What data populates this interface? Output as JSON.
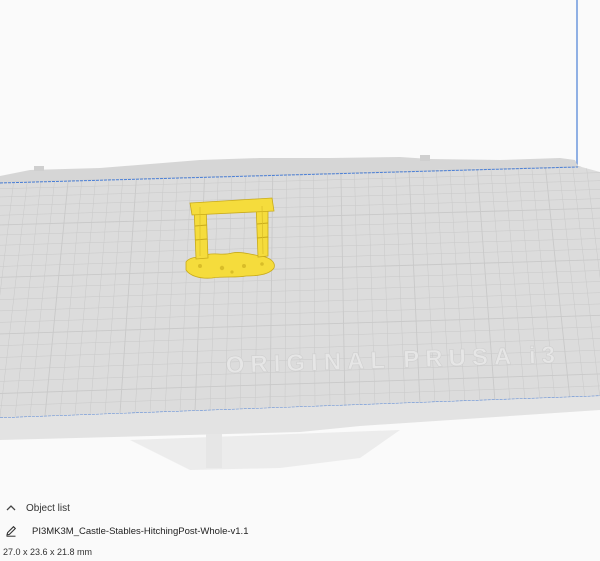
{
  "viewport": {
    "bed_logo_text": "ORIGINAL PRUSA i3",
    "model_color": "#f5dc3c",
    "bed_color": "#dcdcdc",
    "grid_color": "#c9c9c9",
    "edge_color": "#4a7fd6"
  },
  "object_list": {
    "title": "Object list",
    "collapse_icon": "chevron-up-icon",
    "edit_icon": "pencil-icon",
    "object_name": "PI3MK3M_Castle-Stables-HitchingPost-Whole-v1.1",
    "dimensions": "27.0 x 23.6 x 21.8 mm"
  }
}
